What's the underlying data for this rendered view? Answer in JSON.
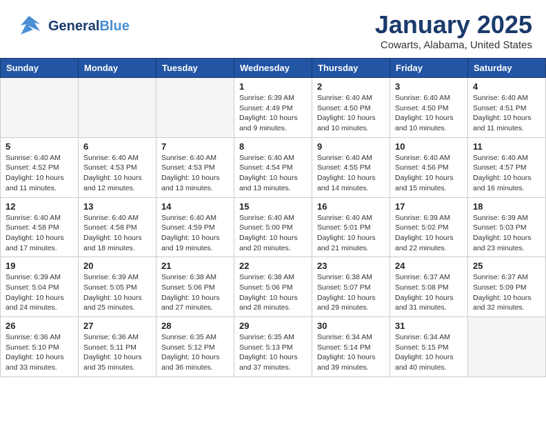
{
  "header": {
    "logo_general": "General",
    "logo_blue": "Blue",
    "month_title": "January 2025",
    "location": "Cowarts, Alabama, United States"
  },
  "days_of_week": [
    "Sunday",
    "Monday",
    "Tuesday",
    "Wednesday",
    "Thursday",
    "Friday",
    "Saturday"
  ],
  "weeks": [
    [
      {
        "day": "",
        "info": ""
      },
      {
        "day": "",
        "info": ""
      },
      {
        "day": "",
        "info": ""
      },
      {
        "day": "1",
        "info": "Sunrise: 6:39 AM\nSunset: 4:49 PM\nDaylight: 10 hours\nand 9 minutes."
      },
      {
        "day": "2",
        "info": "Sunrise: 6:40 AM\nSunset: 4:50 PM\nDaylight: 10 hours\nand 10 minutes."
      },
      {
        "day": "3",
        "info": "Sunrise: 6:40 AM\nSunset: 4:50 PM\nDaylight: 10 hours\nand 10 minutes."
      },
      {
        "day": "4",
        "info": "Sunrise: 6:40 AM\nSunset: 4:51 PM\nDaylight: 10 hours\nand 11 minutes."
      }
    ],
    [
      {
        "day": "5",
        "info": "Sunrise: 6:40 AM\nSunset: 4:52 PM\nDaylight: 10 hours\nand 11 minutes."
      },
      {
        "day": "6",
        "info": "Sunrise: 6:40 AM\nSunset: 4:53 PM\nDaylight: 10 hours\nand 12 minutes."
      },
      {
        "day": "7",
        "info": "Sunrise: 6:40 AM\nSunset: 4:53 PM\nDaylight: 10 hours\nand 13 minutes."
      },
      {
        "day": "8",
        "info": "Sunrise: 6:40 AM\nSunset: 4:54 PM\nDaylight: 10 hours\nand 13 minutes."
      },
      {
        "day": "9",
        "info": "Sunrise: 6:40 AM\nSunset: 4:55 PM\nDaylight: 10 hours\nand 14 minutes."
      },
      {
        "day": "10",
        "info": "Sunrise: 6:40 AM\nSunset: 4:56 PM\nDaylight: 10 hours\nand 15 minutes."
      },
      {
        "day": "11",
        "info": "Sunrise: 6:40 AM\nSunset: 4:57 PM\nDaylight: 10 hours\nand 16 minutes."
      }
    ],
    [
      {
        "day": "12",
        "info": "Sunrise: 6:40 AM\nSunset: 4:58 PM\nDaylight: 10 hours\nand 17 minutes."
      },
      {
        "day": "13",
        "info": "Sunrise: 6:40 AM\nSunset: 4:58 PM\nDaylight: 10 hours\nand 18 minutes."
      },
      {
        "day": "14",
        "info": "Sunrise: 6:40 AM\nSunset: 4:59 PM\nDaylight: 10 hours\nand 19 minutes."
      },
      {
        "day": "15",
        "info": "Sunrise: 6:40 AM\nSunset: 5:00 PM\nDaylight: 10 hours\nand 20 minutes."
      },
      {
        "day": "16",
        "info": "Sunrise: 6:40 AM\nSunset: 5:01 PM\nDaylight: 10 hours\nand 21 minutes."
      },
      {
        "day": "17",
        "info": "Sunrise: 6:39 AM\nSunset: 5:02 PM\nDaylight: 10 hours\nand 22 minutes."
      },
      {
        "day": "18",
        "info": "Sunrise: 6:39 AM\nSunset: 5:03 PM\nDaylight: 10 hours\nand 23 minutes."
      }
    ],
    [
      {
        "day": "19",
        "info": "Sunrise: 6:39 AM\nSunset: 5:04 PM\nDaylight: 10 hours\nand 24 minutes."
      },
      {
        "day": "20",
        "info": "Sunrise: 6:39 AM\nSunset: 5:05 PM\nDaylight: 10 hours\nand 25 minutes."
      },
      {
        "day": "21",
        "info": "Sunrise: 6:38 AM\nSunset: 5:06 PM\nDaylight: 10 hours\nand 27 minutes."
      },
      {
        "day": "22",
        "info": "Sunrise: 6:38 AM\nSunset: 5:06 PM\nDaylight: 10 hours\nand 28 minutes."
      },
      {
        "day": "23",
        "info": "Sunrise: 6:38 AM\nSunset: 5:07 PM\nDaylight: 10 hours\nand 29 minutes."
      },
      {
        "day": "24",
        "info": "Sunrise: 6:37 AM\nSunset: 5:08 PM\nDaylight: 10 hours\nand 31 minutes."
      },
      {
        "day": "25",
        "info": "Sunrise: 6:37 AM\nSunset: 5:09 PM\nDaylight: 10 hours\nand 32 minutes."
      }
    ],
    [
      {
        "day": "26",
        "info": "Sunrise: 6:36 AM\nSunset: 5:10 PM\nDaylight: 10 hours\nand 33 minutes."
      },
      {
        "day": "27",
        "info": "Sunrise: 6:36 AM\nSunset: 5:11 PM\nDaylight: 10 hours\nand 35 minutes."
      },
      {
        "day": "28",
        "info": "Sunrise: 6:35 AM\nSunset: 5:12 PM\nDaylight: 10 hours\nand 36 minutes."
      },
      {
        "day": "29",
        "info": "Sunrise: 6:35 AM\nSunset: 5:13 PM\nDaylight: 10 hours\nand 37 minutes."
      },
      {
        "day": "30",
        "info": "Sunrise: 6:34 AM\nSunset: 5:14 PM\nDaylight: 10 hours\nand 39 minutes."
      },
      {
        "day": "31",
        "info": "Sunrise: 6:34 AM\nSunset: 5:15 PM\nDaylight: 10 hours\nand 40 minutes."
      },
      {
        "day": "",
        "info": ""
      }
    ]
  ]
}
